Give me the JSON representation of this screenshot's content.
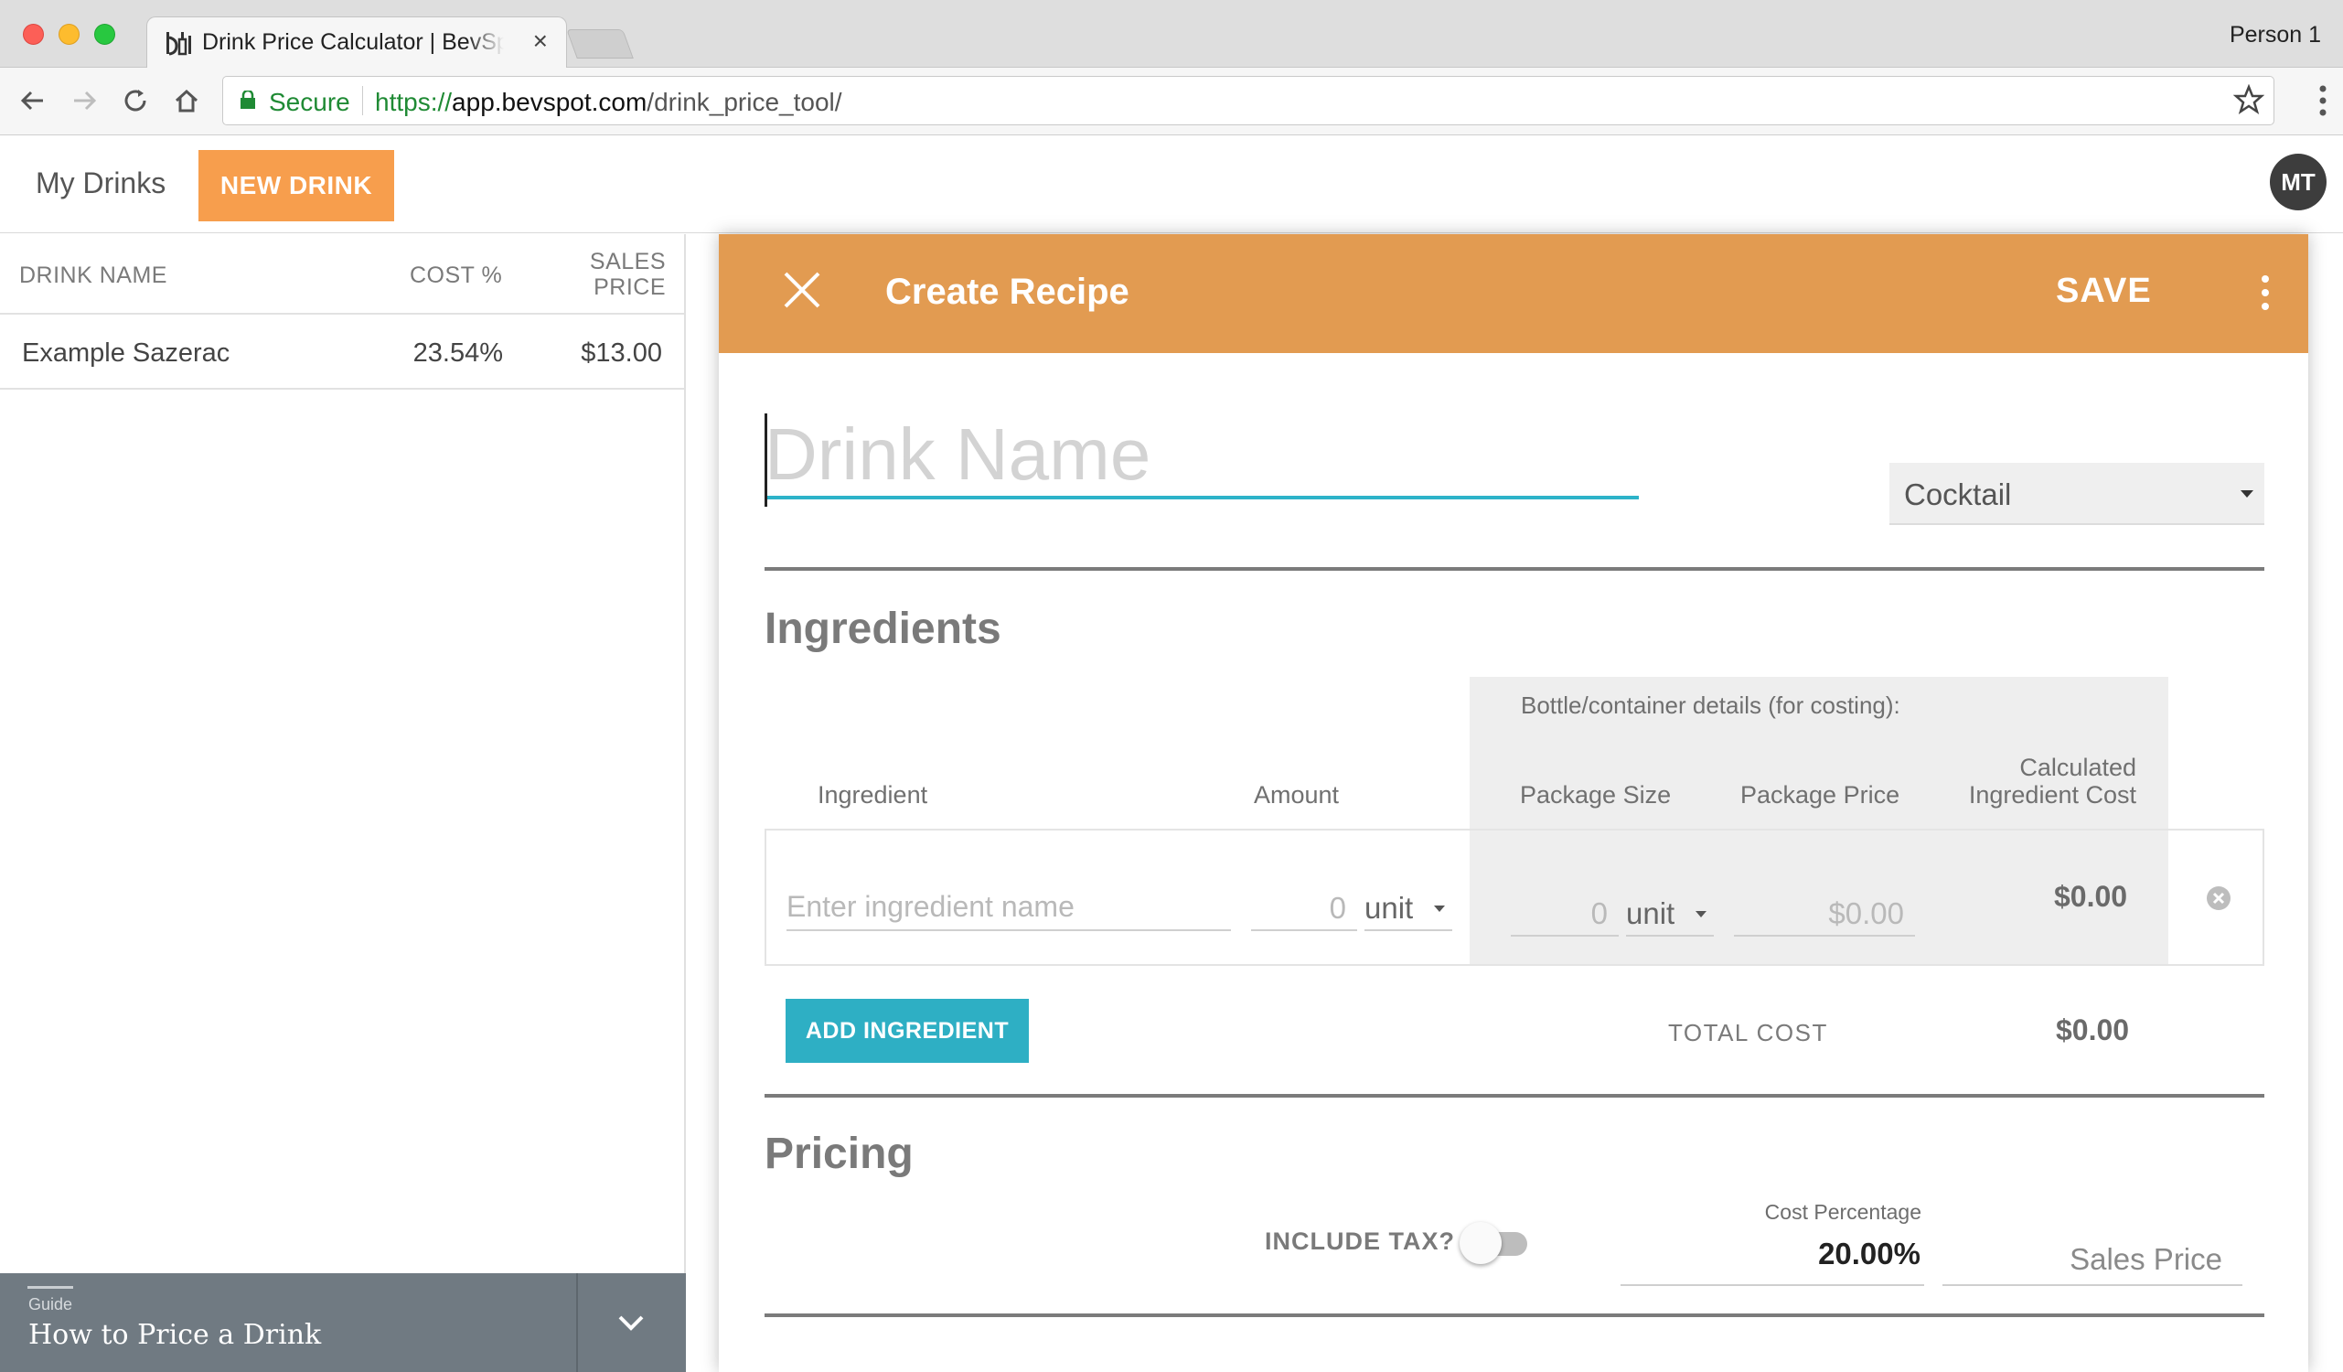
{
  "browser": {
    "tab_title": "Drink Price Calculator | BevSpot",
    "tab_close": "×",
    "profile": "Person 1",
    "secure_label": "Secure",
    "url_scheme": "https://",
    "url_host": "app.bevspot.com",
    "url_path": "/drink_price_tool/"
  },
  "header": {
    "my_drinks": "My Drinks",
    "new_drink": "NEW DRINK",
    "avatar_initials": "MT"
  },
  "drink_list": {
    "columns": {
      "name": "DRINK NAME",
      "cost": "COST %",
      "price_line1": "SALES",
      "price_line2": "PRICE"
    },
    "rows": [
      {
        "name": "Example Sazerac",
        "cost": "23.54%",
        "price": "$13.00"
      }
    ]
  },
  "guide": {
    "label": "Guide",
    "title": "How to Price a Drink"
  },
  "recipe": {
    "title": "Create Recipe",
    "save": "SAVE",
    "name_placeholder": "Drink Name",
    "type": "Cocktail",
    "ingredients_title": "Ingredients",
    "bottle_details_label": "Bottle/container details (for costing):",
    "col_ingredient": "Ingredient",
    "col_amount": "Amount",
    "col_package_size": "Package Size",
    "col_package_price": "Package Price",
    "col_calc_line1": "Calculated",
    "col_calc_line2": "Ingredient Cost",
    "row": {
      "ingredient_placeholder": "Enter ingredient name",
      "amount": "0",
      "amount_unit": "unit",
      "package_size": "0",
      "package_unit": "unit",
      "package_price": "$0.00",
      "calc_cost": "$0.00"
    },
    "add_ingredient": "ADD INGREDIENT",
    "total_cost_label": "TOTAL COST",
    "total_cost": "$0.00",
    "pricing_title": "Pricing",
    "include_tax_label": "INCLUDE TAX?",
    "include_tax": false,
    "cost_percentage_label": "Cost Percentage",
    "cost_percentage": "20.00%",
    "sales_price_placeholder": "Sales Price"
  },
  "colors": {
    "accent_orange": "#e29b51",
    "new_drink_orange": "#f79e4d",
    "teal": "#2eafc4",
    "secure_green": "#1f8a34"
  }
}
